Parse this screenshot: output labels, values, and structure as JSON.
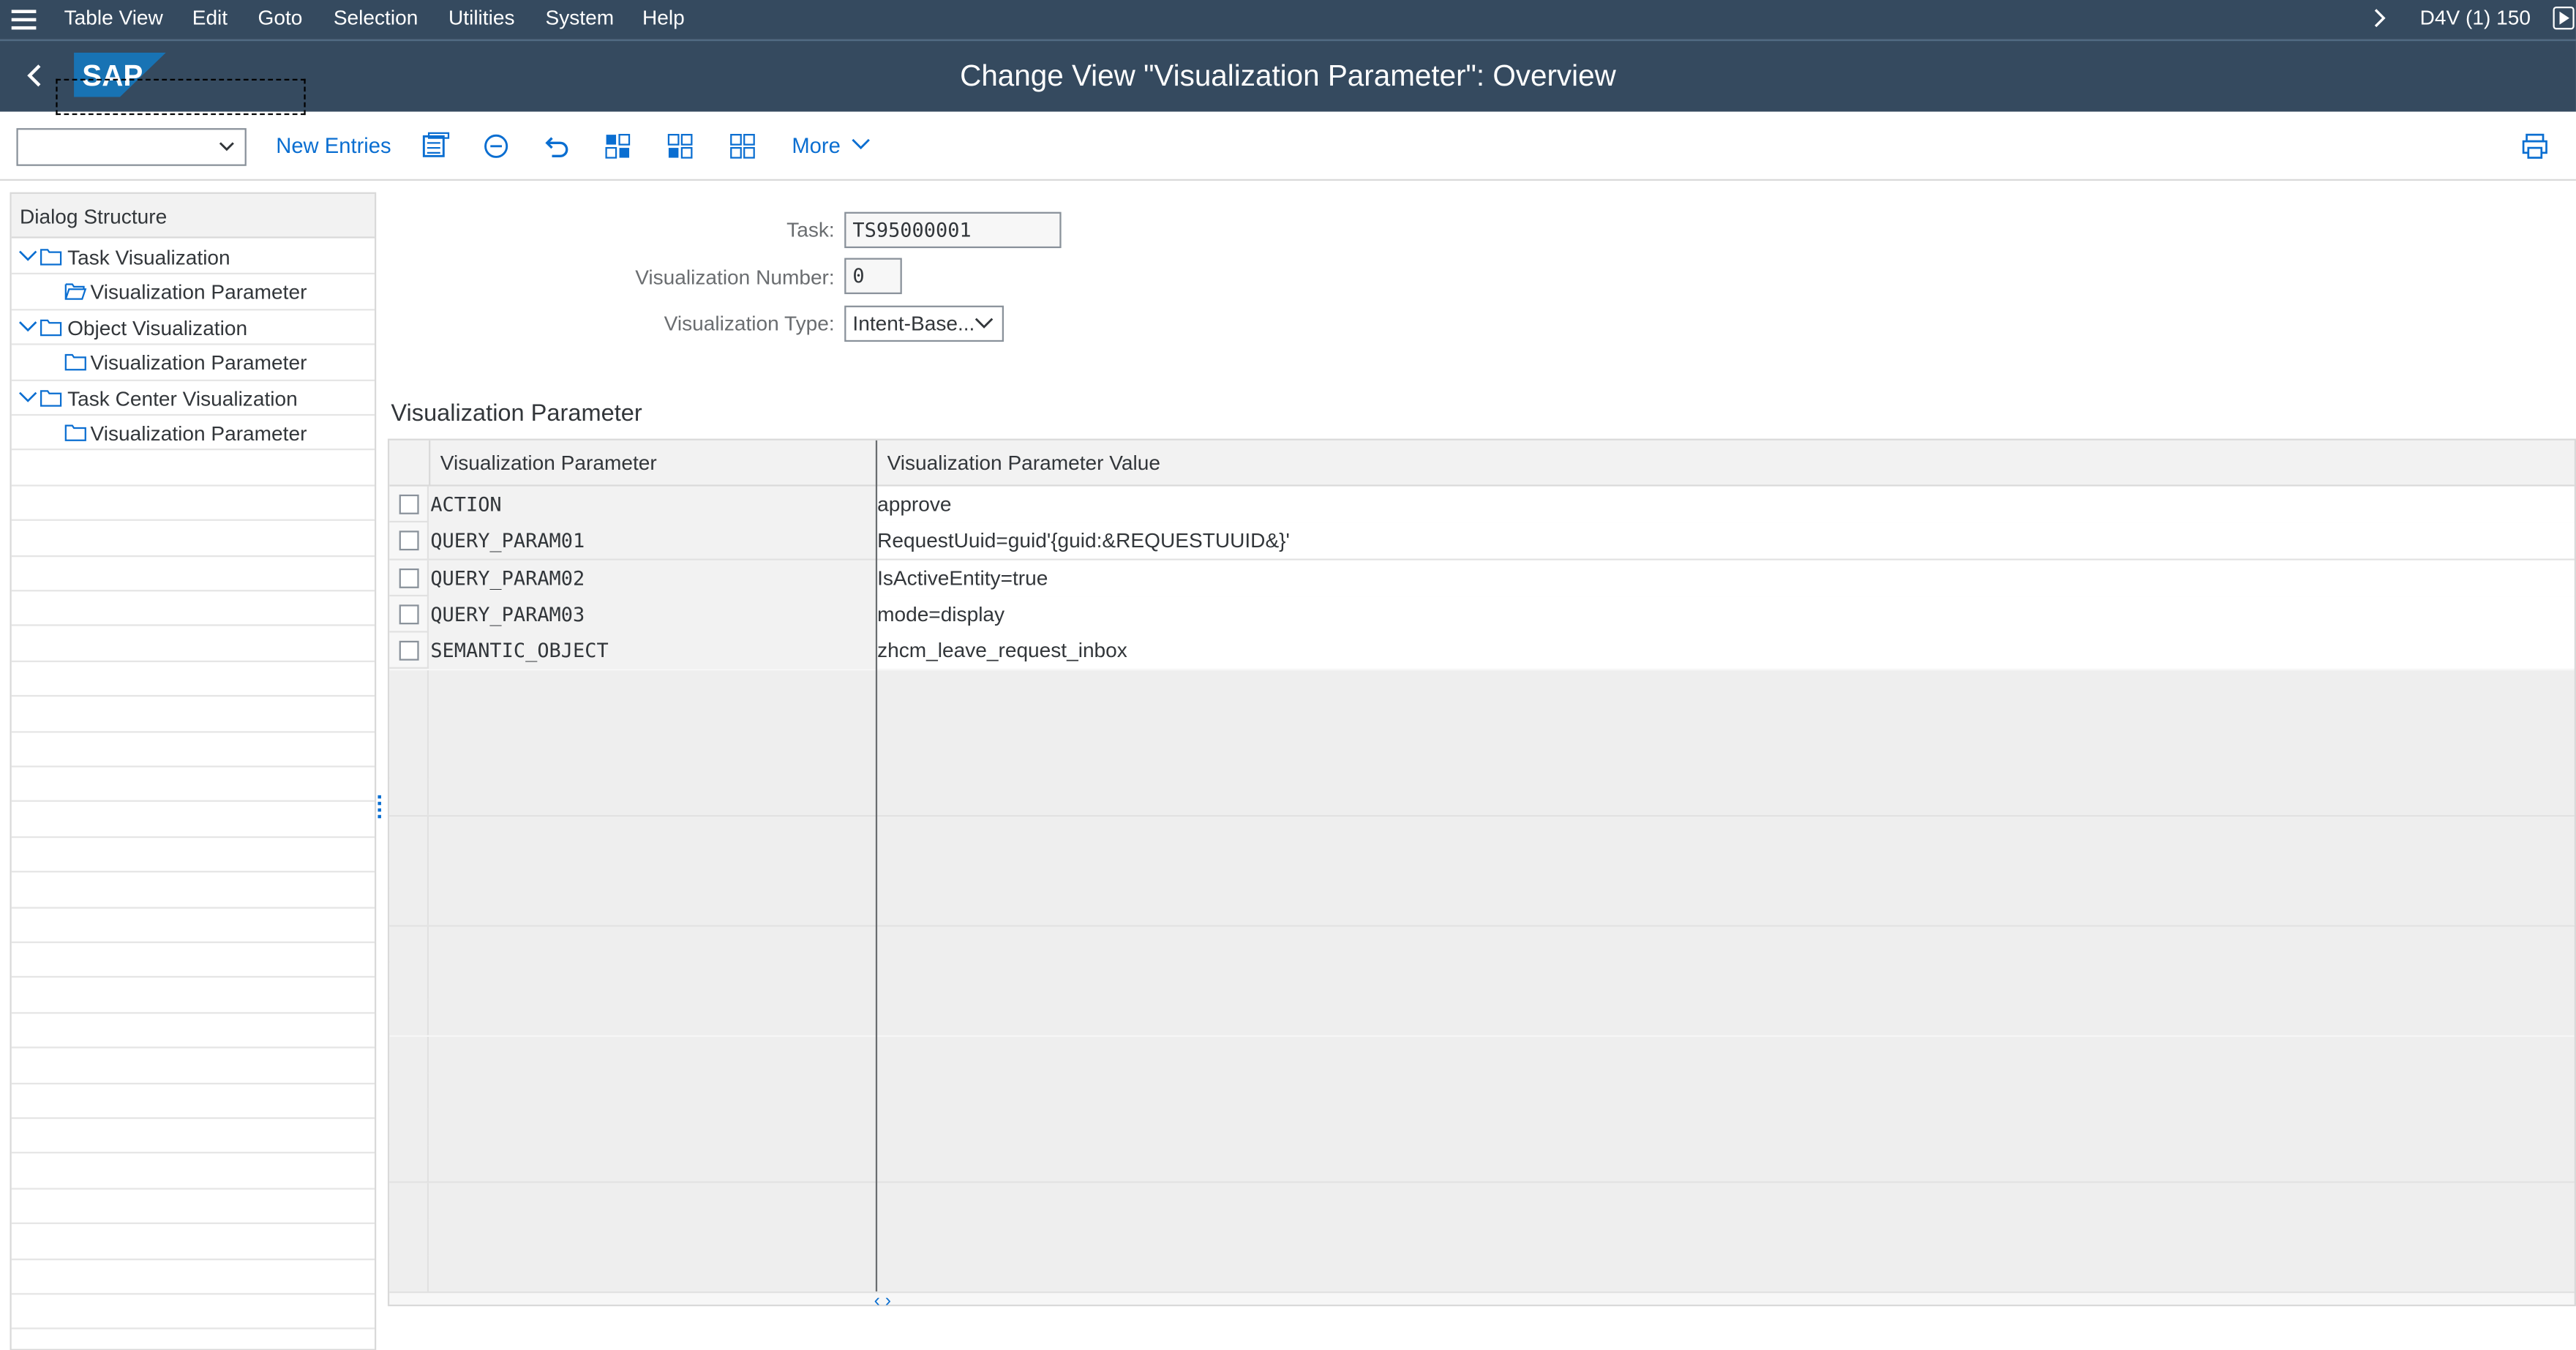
{
  "menubar": {
    "items": [
      "Table View",
      "Edit",
      "Goto",
      "Selection",
      "Utilities",
      "System",
      "Help"
    ],
    "system_info": "D4V (1) 150"
  },
  "shell": {
    "logo_text": "SAP",
    "title": "Change View \"Visualization Parameter\": Overview"
  },
  "toolbar": {
    "dropdown_value": "",
    "new_entries": "New Entries",
    "more": "More"
  },
  "dialog_structure": {
    "header": "Dialog Structure",
    "items": [
      {
        "label": "Task Visualization"
      },
      {
        "label": "Visualization Parameter"
      },
      {
        "label": "Object Visualization"
      },
      {
        "label": "Visualization Parameter"
      },
      {
        "label": "Task Center Visualization"
      },
      {
        "label": "Visualization Parameter"
      }
    ]
  },
  "fields": {
    "task_label": "Task:",
    "task_value": "TS95000001",
    "vis_number_label": "Visualization Number:",
    "vis_number_value": "0",
    "vis_type_label": "Visualization Type:",
    "vis_type_value": "Intent-Base..."
  },
  "section_title": "Visualization Parameter",
  "table": {
    "columns": [
      "Visualization Parameter",
      "Visualization Parameter Value"
    ],
    "rows": [
      {
        "param": "ACTION",
        "value": "approve"
      },
      {
        "param": "QUERY_PARAM01",
        "value": "RequestUuid=guid'{guid:&REQUESTUUID&}'"
      },
      {
        "param": "QUERY_PARAM02",
        "value": "IsActiveEntity=true"
      },
      {
        "param": "QUERY_PARAM03",
        "value": "mode=display"
      },
      {
        "param": "SEMANTIC_OBJECT",
        "value": "zhcm_leave_request_inbox"
      }
    ]
  },
  "colors": {
    "shell_bg": "#354a5f",
    "link_blue": "#0a6ed1",
    "sap_logo": "#1873b4"
  }
}
